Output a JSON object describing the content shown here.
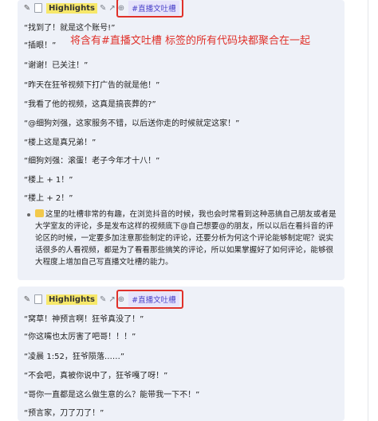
{
  "block1": {
    "toolbar": {
      "highlights_label": "Highlights",
      "tag": "#直播文吐槽"
    },
    "annotation": "将含有#直播文吐槽 标签的所有代码块都聚合在一起",
    "lines": [
      "“找到了！就是这个账号!”",
      "“插眼！”",
      "“谢谢！已关注！”",
      "“昨天在狂爷视频下打广告的就是他！”",
      "“我看了他的视频，这真是搞丧葬的?”",
      "“@细狗刘强，这家服务不错，以后送你走的时候就定这家！”",
      "“楼上这是真兄弟！”",
      "“细狗刘强：滚蛋！老子今年才十八！”",
      "“楼上 + 1！”",
      "“楼上 + 2！”"
    ],
    "note": "这里的吐槽非常的有趣，在浏览抖音的时候，我也会时常看到这种恶搞自己朋友或者是大学室友的评论，多是发布这样的视频底下@自己想要@的朋友，所以以后在看抖音的评论区的时候，一定要多加注意那些制定的评论，还要分析为何这个评论能够制定呢？说实话很多的人看视频，都是为了看看那些搞笑的评论，所以如果掌握好了如何评论，能够很大程度上增加自己写直播文吐槽的能力。"
  },
  "block2": {
    "toolbar": {
      "highlights_label": "Highlights",
      "tag": "#直播文吐槽"
    },
    "lines": [
      "“窝草！神预言啊！狂爷真没了！”",
      "“你这嘴也太厉害了吧哥！！！”",
      "“凌晨 1:52，狂爷陨落……”",
      "“不会吧，真被你说中了，狂爷嘎了呀！”",
      "“哥你一直都是这么做生意的么？能带我一下不！”",
      "“预言家，刀了刀了！”"
    ]
  },
  "colors": {
    "block_bg": "#eef1f8",
    "highlight": "#f7e86a",
    "tag_text": "#4b43c9",
    "tag_bg": "#e6e3fb",
    "annotation_red": "#e0312a"
  }
}
